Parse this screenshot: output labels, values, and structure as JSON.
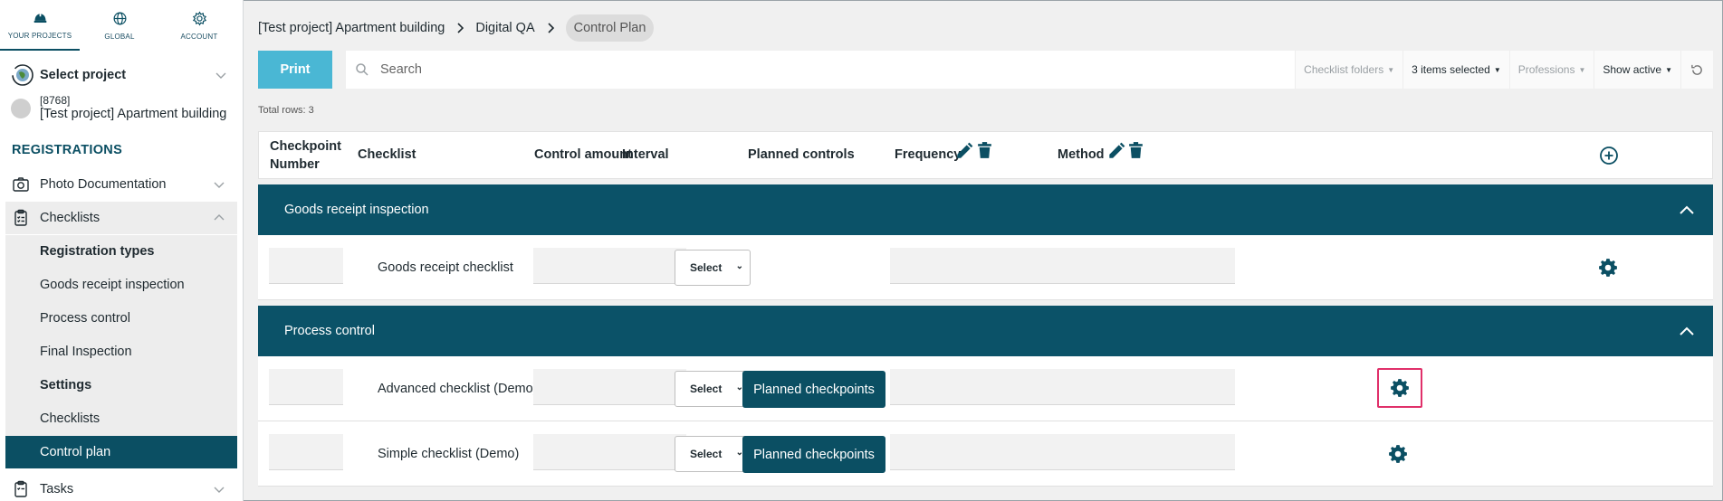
{
  "nav": {
    "tabs": [
      {
        "label": "YOUR PROJECTS",
        "icon": "hardhat-icon"
      },
      {
        "label": "GLOBAL",
        "icon": "globe-icon"
      },
      {
        "label": "ACCOUNT",
        "icon": "gear-icon"
      }
    ]
  },
  "project": {
    "select_label": "Select project",
    "code": "[8768]",
    "name": "[Test project] Apartment building"
  },
  "sidebar": {
    "section": "REGISTRATIONS",
    "items": [
      {
        "label": "Photo Documentation"
      },
      {
        "label": "Checklists"
      },
      {
        "label": "Tasks"
      }
    ],
    "sub": [
      {
        "label": "Registration types"
      },
      {
        "label": "Goods receipt inspection"
      },
      {
        "label": "Process control"
      },
      {
        "label": "Final Inspection"
      },
      {
        "label": "Settings"
      },
      {
        "label": "Checklists"
      },
      {
        "label": "Control plan"
      }
    ]
  },
  "breadcrumb": [
    "[Test project] Apartment building",
    "Digital QA",
    "Control Plan"
  ],
  "toolbar": {
    "print": "Print",
    "search_placeholder": "Search",
    "filters": [
      "Checklist folders",
      "3 items selected",
      "Professions",
      "Show active"
    ]
  },
  "total_rows": "Total rows: 3",
  "table": {
    "headers": {
      "checkpoint_1": "Checkpoint",
      "checkpoint_2": "Number",
      "checklist": "Checklist",
      "control_amount": "Control amount",
      "interval": "Interval",
      "planned": "Planned controls",
      "frequency": "Frequency",
      "method": "Method"
    },
    "groups": [
      {
        "title": "Goods receipt inspection",
        "rows": [
          {
            "checklist": "Goods receipt checklist",
            "select": "Select"
          }
        ]
      },
      {
        "title": "Process control",
        "rows": [
          {
            "checklist": "Advanced checklist (Demo)",
            "select": "Select",
            "planned": "Planned checkpoints"
          },
          {
            "checklist": "Simple checklist (Demo)",
            "select": "Select",
            "planned": "Planned checkpoints"
          }
        ]
      }
    ]
  },
  "colors": {
    "primary": "#0b4f63",
    "print": "#4ab7d4",
    "highlight": "#e0306a"
  }
}
